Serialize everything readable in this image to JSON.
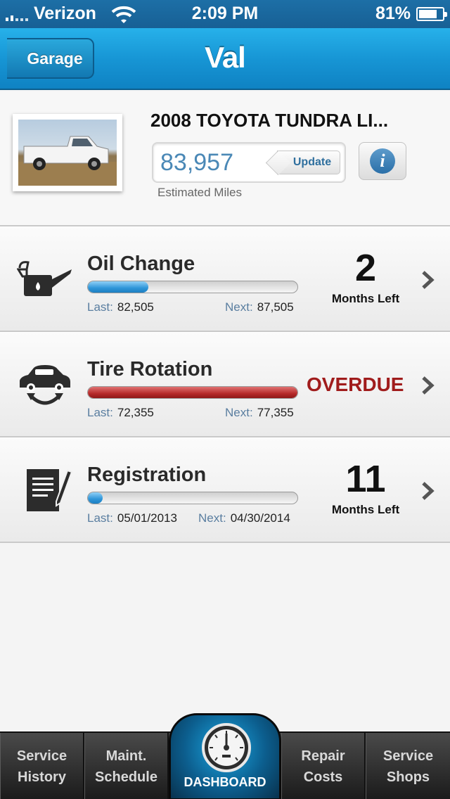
{
  "status_bar": {
    "carrier": "Verizon",
    "time": "2:09 PM",
    "battery": "81%",
    "battery_level": 0.81
  },
  "nav": {
    "back_label": "Garage",
    "title": "Val"
  },
  "vehicle": {
    "name": "2008 TOYOTA TUNDRA LI...",
    "miles": "83,957",
    "update_label": "Update",
    "miles_caption": "Estimated Miles",
    "info_label": "i"
  },
  "services": [
    {
      "title": "Oil Change",
      "progress": 0.29,
      "bar_color": "blue",
      "last_label": "Last:",
      "last_value": "82,505",
      "next_label": "Next:",
      "next_value": "87,505",
      "status_number": "2",
      "status_label": "Months Left",
      "icon": "oil-can-icon"
    },
    {
      "title": "Tire Rotation",
      "progress": 1.0,
      "bar_color": "red",
      "last_label": "Last:",
      "last_value": "72,355",
      "next_label": "Next:",
      "next_value": "77,355",
      "status_text": "OVERDUE",
      "status_color": "#a01c1c",
      "icon": "tire-rotation-icon"
    },
    {
      "title": "Registration",
      "progress": 0.07,
      "bar_color": "blue",
      "last_label": "Last:",
      "last_value": "05/01/2013",
      "next_label": "Next:",
      "next_value": "04/30/2014",
      "status_number": "11",
      "status_label": "Months Left",
      "icon": "registration-document-icon"
    }
  ],
  "tabs": {
    "service_history": [
      "Service",
      "History"
    ],
    "maint_schedule": [
      "Maint.",
      "Schedule"
    ],
    "dashboard": "DASHBOARD",
    "repair_costs": [
      "Repair",
      "Costs"
    ],
    "service_shops": [
      "Service",
      "Shops"
    ]
  }
}
